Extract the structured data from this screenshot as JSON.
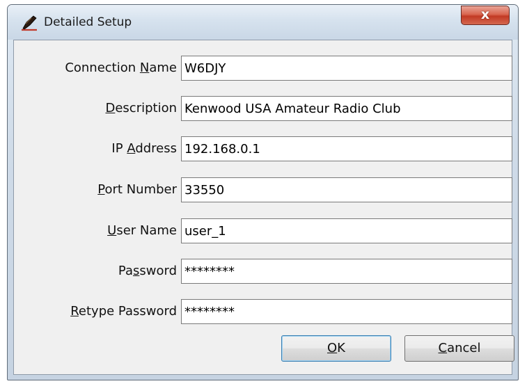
{
  "window": {
    "title": "Detailed Setup",
    "close_glyph": "x",
    "icon": "pen-icon"
  },
  "fields": [
    {
      "label_pre": "Connection ",
      "label_key": "N",
      "label_post": "ame",
      "value": "W6DJY"
    },
    {
      "label_pre": "",
      "label_key": "D",
      "label_post": "escription",
      "value": "Kenwood USA Amateur Radio Club"
    },
    {
      "label_pre": "IP ",
      "label_key": "A",
      "label_post": "ddress",
      "value": "192.168.0.1"
    },
    {
      "label_pre": "",
      "label_key": "P",
      "label_post": "ort Number",
      "value": "33550"
    },
    {
      "label_pre": "",
      "label_key": "U",
      "label_post": "ser Name",
      "value": "user_1"
    },
    {
      "label_pre": "Pa",
      "label_key": "s",
      "label_post": "sword",
      "value": "********"
    },
    {
      "label_pre": "",
      "label_key": "R",
      "label_post": "etype Password",
      "value": "********"
    }
  ],
  "buttons": {
    "ok": {
      "key": "O",
      "rest": "K"
    },
    "cancel": {
      "key": "C",
      "rest": "ancel"
    }
  },
  "colors": {
    "close_button": "#c23a24",
    "default_button_border": "#3c7fb1"
  }
}
